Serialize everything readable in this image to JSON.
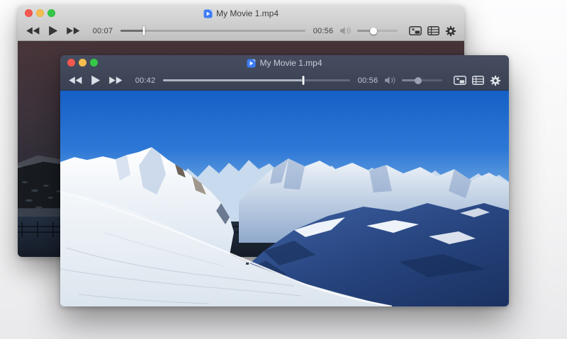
{
  "desktop": {
    "background_top": "#fdfdfe",
    "background_bottom": "#e9e9eb"
  },
  "windows": [
    {
      "id": "background-player",
      "title": "My Movie 1.mp4",
      "theme": "light",
      "traffic": {
        "close": "#f3584f",
        "minimize": "#f6bd4e",
        "zoom": "#35c748"
      },
      "transport_icons": [
        "rewind-icon",
        "play-icon",
        "fast-forward-icon"
      ],
      "elapsed": "00:07",
      "duration": "00:56",
      "progress_pct": "12.5%",
      "volume_pct": "40%",
      "right_icons": [
        "speaker-icon",
        "pip-icon",
        "chapters-icon",
        "gear-icon"
      ],
      "video_scene": "dark dusk mountainside with snow patches and a wooden fence"
    },
    {
      "id": "foreground-player",
      "title": "My Movie 1.mp4",
      "theme": "dark",
      "traffic": {
        "close": "#f3584f",
        "minimize": "#f6bd4e",
        "zoom": "#35c748"
      },
      "transport_icons": [
        "rewind-icon",
        "play-icon",
        "fast-forward-icon"
      ],
      "elapsed": "00:42",
      "duration": "00:56",
      "progress_pct": "75%",
      "volume_pct": "40%",
      "right_icons": [
        "speaker-icon",
        "pip-icon",
        "chapters-icon",
        "gear-icon"
      ],
      "video_scene": "sunlit snowy alpine panorama under blue sky with shadowed valley and ski tracks"
    }
  ]
}
